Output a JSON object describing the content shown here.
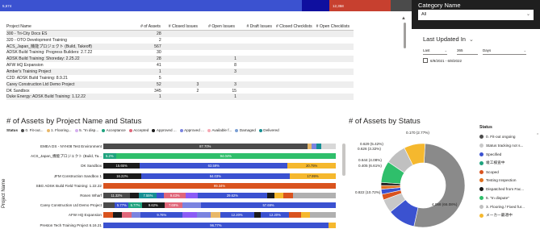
{
  "top_strip": {
    "segments": [
      {
        "color": "#3b52d0",
        "label": "5,674"
      },
      {
        "color": "#0f0f9f",
        "label": ""
      },
      {
        "color": "#c7402f",
        "label": "12,358"
      },
      {
        "color": "#4b4b4b",
        "label": ""
      }
    ]
  },
  "table": {
    "columns": [
      "Project Name",
      "# of Assets",
      "# Closed Issues",
      "# Open Issues",
      "# Draft Issues",
      "# Closed Checklists",
      "# Open Checklists"
    ],
    "rows": [
      [
        "300 - Tri-City Docs ES",
        "28",
        "",
        "",
        "",
        "",
        ""
      ],
      [
        "320 - OTO Development Training",
        "2",
        "",
        "",
        "",
        "",
        ""
      ],
      [
        "ACS_Japan_機能プロジェクト (Build, Takeoff)",
        "567",
        "",
        "",
        "",
        "",
        ""
      ],
      [
        "ADSK Build Training: Progress Builders: 2.7.22",
        "30",
        "",
        "",
        "",
        "",
        ""
      ],
      [
        "ADSK Build Training: Shoreday: 2.25.22",
        "28",
        "",
        "1",
        "",
        "",
        ""
      ],
      [
        "AFW HQ Expansion",
        "41",
        "",
        "8",
        "",
        "",
        ""
      ],
      [
        "Amber's Training Project",
        "1",
        "",
        "3",
        "",
        "",
        ""
      ],
      [
        "C2D: ADSK Build Training: 8.9.21",
        "5",
        "",
        "",
        "",
        "",
        ""
      ],
      [
        "Carey Construction Ltd Demo Project",
        "52",
        "3",
        "3",
        "",
        "",
        ""
      ],
      [
        "DK Sandbox",
        "345",
        "2",
        "15",
        "",
        "",
        ""
      ],
      [
        "Duke Energy: ADSK Build Training: 1.12.22",
        "1",
        "",
        "1",
        "",
        "",
        ""
      ]
    ]
  },
  "category_filter": {
    "title": "Category Name",
    "selected": "All",
    "chevron_icon": "chevron-down-icon"
  },
  "last_updated": {
    "title": "Last Updated In",
    "mode": "Last",
    "value": "365",
    "unit": "Days",
    "range": "6/9/2021 - 6/8/2022"
  },
  "bar_chart": {
    "title": "# of Assets by Project Name and Status",
    "status_label": "Status",
    "ylabel": "Project Name",
    "legend": [
      {
        "label": "0. Fit-out...",
        "color": "#4b4b4b"
      },
      {
        "label": "1. Flooring...",
        "color": "#e8b86a"
      },
      {
        "label": "5. \"In disp...",
        "color": "#d6b0f0"
      },
      {
        "label": "Acceptance",
        "color": "#1fa37e"
      },
      {
        "label": "Accepted",
        "color": "#e0677a"
      },
      {
        "label": "Approved ...",
        "color": "#1b1b1b"
      },
      {
        "label": "Approved ...",
        "color": "#7b84e0"
      },
      {
        "label": "Available f...",
        "color": "#f7a7b3"
      },
      {
        "label": "Damaged",
        "color": "#7a9fd4"
      },
      {
        "label": "Delivered",
        "color": "#168f93"
      }
    ]
  },
  "chart_data": [
    {
      "type": "bar",
      "orientation": "horizontal",
      "stacked": "100%",
      "title": "# of Assets by Project Name and Status",
      "ylabel": "Project Name",
      "categories": [
        "EMEA DS - NYH08 Test Environment",
        "ACS_Japan_機能プロジェクト (Build, Ta...",
        "DK Sandbox",
        "JFM Construction Sandbox 1",
        "SBG ADSK Build Field Training: 1.22.22",
        "Rosen Wharf",
        "Carey Construction Ltd Demo Project",
        "AFW HQ Expansion",
        "Preston Tech Training Project 6.16.21"
      ],
      "bars": [
        [
          {
            "c": "#4b4b4b",
            "v": 87.7,
            "label": "87.70%"
          },
          {
            "c": "#e8b86a",
            "v": 2
          },
          {
            "c": "#7b84e0",
            "v": 2
          },
          {
            "c": "#168f93",
            "v": 2
          },
          {
            "c": "#d8d8d8",
            "v": 6.3
          }
        ],
        [
          {
            "c": "#1fa37e",
            "v": 5.4,
            "label": "5.2%"
          },
          {
            "c": "#2fbf6b",
            "v": 94.6,
            "label": "94.04%"
          }
        ],
        [
          {
            "c": "#1b1b1b",
            "v": 15.7,
            "label": "15.65%"
          },
          {
            "c": "#3b52d0",
            "v": 63.6,
            "label": "63.59%"
          },
          {
            "c": "#f5b82e",
            "v": 20.7,
            "label": "20.75%"
          }
        ],
        [
          {
            "c": "#1b1b1b",
            "v": 16.2,
            "label": "16.22%"
          },
          {
            "c": "#3b52d0",
            "v": 64.0,
            "label": "64.03%"
          },
          {
            "c": "#f5b82e",
            "v": 19.8,
            "label": "17.99%"
          }
        ],
        [
          {
            "c": "#d9531e",
            "v": 100,
            "label": "99.34%"
          }
        ],
        [
          {
            "c": "#4b4b4b",
            "v": 11.3,
            "label": "11.32%"
          },
          {
            "c": "#1b1b1b",
            "v": 4
          },
          {
            "c": "#168f93",
            "v": 7.5,
            "label": "7.55%"
          },
          {
            "c": "#3b52d0",
            "v": 3
          },
          {
            "c": "#e0677a",
            "v": 9.4,
            "label": "9.43%"
          },
          {
            "c": "#8b5cf6",
            "v": 5
          },
          {
            "c": "#3b52d0",
            "v": 29.6,
            "label": "29.62%"
          },
          {
            "c": "#1b1b1b",
            "v": 3
          },
          {
            "c": "#f5b82e",
            "v": 4
          },
          {
            "c": "#d9531e",
            "v": 4
          },
          {
            "c": "#b0b0b0",
            "v": 18.2
          }
        ],
        [
          {
            "c": "#4b4b4b",
            "v": 5
          },
          {
            "c": "#3b52d0",
            "v": 5.8,
            "label": "5.77%"
          },
          {
            "c": "#1fa37e",
            "v": 5.77,
            "label": "5.77%"
          },
          {
            "c": "#1b1b1b",
            "v": 9.6,
            "label": "9.62%"
          },
          {
            "c": "#e0677a",
            "v": 7.7,
            "label": "7.69%"
          },
          {
            "c": "#7b84e0",
            "v": 8
          },
          {
            "c": "#3b52d0",
            "v": 57.6,
            "label": "57.69%"
          }
        ],
        [
          {
            "c": "#d9531e",
            "v": 4
          },
          {
            "c": "#1b1b1b",
            "v": 4
          },
          {
            "c": "#e0677a",
            "v": 4
          },
          {
            "c": "#7b84e0",
            "v": 4
          },
          {
            "c": "#3b52d0",
            "v": 18.2,
            "label": "9.76%"
          },
          {
            "c": "#8b5cf6",
            "v": 6
          },
          {
            "c": "#7b84e0",
            "v": 6
          },
          {
            "c": "#e8b86a",
            "v": 4
          },
          {
            "c": "#3b52d0",
            "v": 14.6,
            "label": "12.20%"
          },
          {
            "c": "#1b1b1b",
            "v": 3
          },
          {
            "c": "#3b52d0",
            "v": 12.2,
            "label": "12.20%"
          },
          {
            "c": "#d9531e",
            "v": 5
          },
          {
            "c": "#f5b82e",
            "v": 4
          },
          {
            "c": "#b0b0b0",
            "v": 11
          }
        ],
        [
          {
            "c": "#3b52d0",
            "v": 96.77,
            "label": "96.77%"
          },
          {
            "c": "#f5b82e",
            "v": 3.23
          }
        ]
      ]
    },
    {
      "type": "pie",
      "style": "donut",
      "title": "# of Assets by Status",
      "legend_title": "Status",
      "slices": [
        {
          "label": "0. Fit-out ongoing",
          "value": 4058,
          "color": "#8a8a8a",
          "text": "4,058 (66.08%)"
        },
        {
          "label": "Specified",
          "value": 822,
          "color": "#3b52d0",
          "text": "0.822 (10.72%)"
        },
        {
          "label": "Status tracking not s...",
          "value": 405,
          "color": "#c8c8c8",
          "text": "0.405 (6.61%)"
        },
        {
          "label": "Scoped",
          "value": 170,
          "color": "#d9531e",
          "text": "0.170 (2.77%)"
        },
        {
          "label": "竣工検査中",
          "value": 150,
          "color": "#3b52d0",
          "text": ""
        },
        {
          "label": "Testing Inspection",
          "value": 110,
          "color": "#e07020",
          "text": ""
        },
        {
          "label": "Dispatched from Fac...",
          "value": 90,
          "color": "#1b1b1b",
          "text": ""
        },
        {
          "label": "5. \"In dispute\"",
          "value": 644,
          "color": "#2fbf6b",
          "text": "0.644 (4.08%)"
        },
        {
          "label": "3. Flooring / Fixed fur...",
          "value": 629,
          "color": "#c0c0c0",
          "text": "0.629 (5.42%)"
        },
        {
          "label": "メーカー最適中",
          "value": 626,
          "color": "#f5b82e",
          "text": "0.626 (3.32%)"
        }
      ],
      "outer_labels": [
        "0.629 (5.42%)",
        "0.626 (3.32%)",
        "0.644 (4.08%)",
        "0.405 (6.61%)",
        "0.822 (10.72%)",
        "4,058 (66.08%)",
        "0.170 (2.77%)"
      ]
    }
  ],
  "donut_legend": {
    "title": "Status",
    "items": [
      {
        "label": "0. Fit-out ongoing",
        "color": "#4b4b4b"
      },
      {
        "label": "Status tracking not s...",
        "color": "#c8c8c8"
      },
      {
        "label": "Specified",
        "color": "#3b52d0"
      },
      {
        "label": "竣工検査中",
        "color": "#1fa37e"
      },
      {
        "label": "Scoped",
        "color": "#d9531e"
      },
      {
        "label": "Testing Inspection",
        "color": "#e07020"
      },
      {
        "label": "Dispatched from Fac...",
        "color": "#1b1b1b"
      },
      {
        "label": "5. \"In dispute\"",
        "color": "#2fbf6b"
      },
      {
        "label": "3. Flooring / Fixed fur...",
        "color": "#c0c0c0"
      },
      {
        "label": "メーカー最適中",
        "color": "#f5b82e"
      }
    ]
  }
}
